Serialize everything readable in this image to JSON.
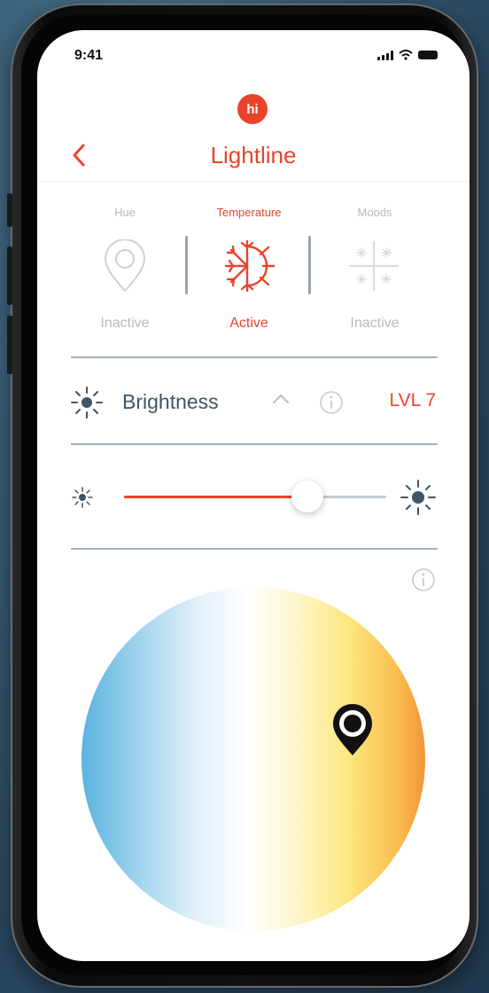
{
  "status_bar": {
    "time": "9:41"
  },
  "app": {
    "logo_text": "hi",
    "title": "Lightline",
    "accent_color": "#e8442b"
  },
  "modes": [
    {
      "label": "Hue",
      "status": "Inactive",
      "icon": "map-pin-icon",
      "active": false
    },
    {
      "label": "Temperature",
      "status": "Active",
      "icon": "sun-snowflake-icon",
      "active": true
    },
    {
      "label": "Moods",
      "status": "Inactive",
      "icon": "moods-grid-icon",
      "active": false
    }
  ],
  "brightness": {
    "label": "Brightness",
    "level_text": "LVL 7",
    "slider_fraction": 0.7
  },
  "temperature_wheel": {
    "cool_color": "#5bb3e0",
    "warm_color": "#f1953a"
  }
}
